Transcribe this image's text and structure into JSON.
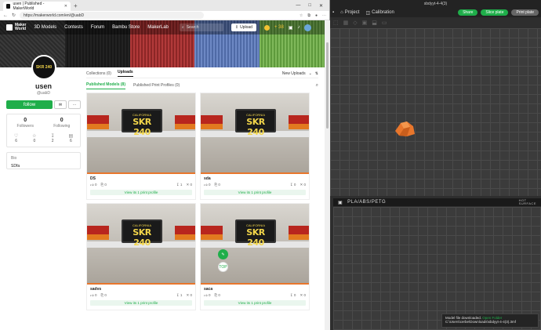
{
  "browser": {
    "tab_title": "usen | Published - MakerWorld",
    "url": "https://makerworld.com/en/@uabD",
    "win_min": "—",
    "win_max": "□",
    "win_close": "✕"
  },
  "site": {
    "logo_line1": "Maker",
    "logo_line2": "World",
    "nav": [
      "3D Models",
      "Contests",
      "Forum",
      "Bambu Store",
      "MakerLab"
    ],
    "search_placeholder": "Search",
    "upload_label": "Upload",
    "points": "+ 38"
  },
  "profile": {
    "avatar_text": "SKR 240",
    "username": "usen",
    "handle": "@uabD",
    "follow_label": "follow",
    "followers_count": "0",
    "followers_label": "Followers",
    "following_count": "0",
    "following_label": "Following",
    "stat_counts": [
      "6",
      "0",
      "2",
      "6"
    ],
    "bio_title": "Bio",
    "bio_text": "SDfa"
  },
  "content": {
    "tab_collections": "Collections (0)",
    "tab_uploads": "Uploads",
    "sort_label": "New Uploads",
    "subtab_published": "Published Models (8)",
    "subtab_profiles": "Published Print Profiles (0)",
    "cards": [
      {
        "name": "DS",
        "likes": "0",
        "collects": "0",
        "downloads": "1",
        "prints": "0",
        "link": "View its 1 print profile"
      },
      {
        "name": "sda",
        "likes": "0",
        "collects": "0",
        "downloads": "0",
        "prints": "0",
        "link": "View its 1 print profile"
      },
      {
        "name": "sadvs",
        "likes": "0",
        "collects": "0",
        "downloads": "1",
        "prints": "0",
        "link": "View its 1 print profile"
      },
      {
        "name": "saca",
        "likes": "0",
        "collects": "0",
        "downloads": "0",
        "prints": "0",
        "link": "View its 1 print profile"
      }
    ],
    "plate_state": "CALIFORNIA",
    "plate_number": "SKR 240",
    "top_label": "TOP"
  },
  "studio": {
    "title": "sbdyyt-4-4(3)",
    "tab_project": "Project",
    "tab_calibration": "Calibration",
    "share_label": "Share",
    "slice_label": "Slice plate",
    "print_label": "Print plate",
    "plate_text": "PLA/ABS/PETG",
    "hot_line1": "HOT",
    "hot_line2": "SURFACE",
    "toast_text": "Model file downloaded.",
    "toast_link": "Open Folder",
    "toast_path": "C:\\Users\\cerbe\\Downloads\\sbdyyt-4-4(3).3mf"
  },
  "colors": {
    "accent": "#1fae4a",
    "model": "#e8762c"
  }
}
